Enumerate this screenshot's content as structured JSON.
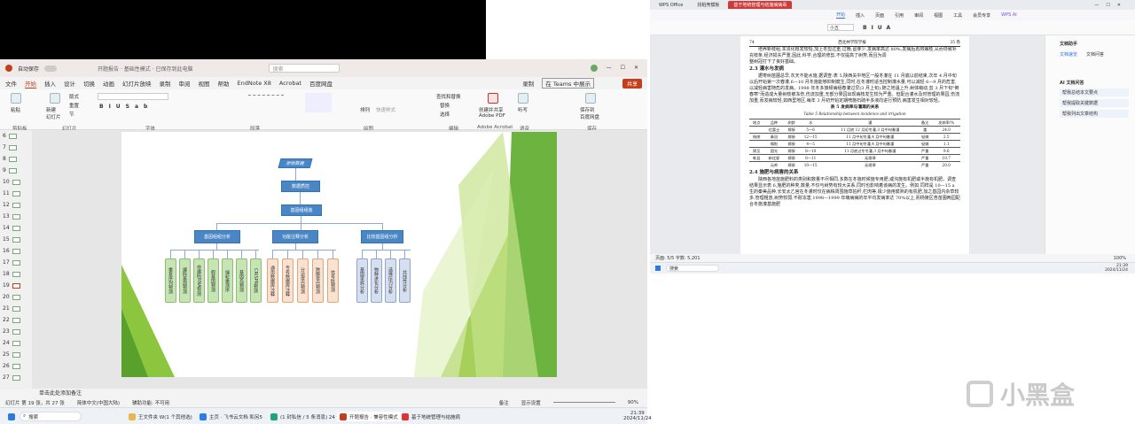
{
  "ppt": {
    "quick_access": "自动保存",
    "title_center": "开题报告 · 基础性模式 · 已保存到此电脑",
    "search_placeholder": "搜索",
    "menu": [
      "文件",
      "开始",
      "插入",
      "设计",
      "切换",
      "动画",
      "幻灯片放映",
      "录制",
      "审阅",
      "视图",
      "帮助",
      "EndNote X8",
      "Acrobat",
      "百度网盘"
    ],
    "active_menu": "开始",
    "record_label": "录制",
    "teams_label": "在 Teams 中展示",
    "share_label": "共享",
    "ribbon": {
      "paste": "粘贴",
      "new_slide": "新建\n幻灯片",
      "layout": "版式",
      "reset": "重置",
      "section": "节",
      "groups": [
        "剪贴板",
        "幻灯片",
        "字体",
        "段落",
        "绘图",
        "编辑",
        "Adobe Acrobat",
        "语音",
        "保存"
      ],
      "arrange": "排列",
      "quick_styles": "快速样式",
      "find": "查找和替换",
      "replace": "替换",
      "select": "选择",
      "create_pdf": "创建并共享\nAdobe PDF",
      "dictate": "听写",
      "save_baidu": "保存到\n百度网盘"
    },
    "thumbnails": [
      6,
      7,
      8,
      9,
      10,
      11,
      12,
      13,
      14,
      15,
      16,
      17,
      18,
      19,
      20,
      21,
      22,
      23,
      24,
      25,
      26,
      27
    ],
    "selected_thumb": 19,
    "slide": {
      "top": "原始数据",
      "step2": "数据质控",
      "step3": "基因组组装",
      "mid": [
        "基因组组分析",
        "功能注释分析",
        "比较基因组分析"
      ],
      "leaves_green": [
        "重复序列预测",
        "编码基因预测",
        "非编码RNA预测",
        "假基因预测",
        "端粒重测序",
        "基因岛预测",
        "CRISPR预测"
      ],
      "leaves_orange": [
        "通用数据库注释",
        "专有数据库注释",
        "分泌蛋白预测",
        "跨膜蛋白预测",
        "信号肽预测"
      ],
      "leaves_blue": [
        "基因家族分析",
        "物种进化分析",
        "选择压力分析",
        "共线性分析"
      ]
    },
    "notes_placeholder": "单击此处添加备注",
    "status": {
      "slide_count": "幻灯片 第 19 张，共 27 张",
      "language": "简体中文(中国大陆)",
      "accessibility": "辅助功能: 不可用",
      "notes": "备注",
      "display": "显示设置",
      "zoom": "90%"
    }
  },
  "taskbar_left": {
    "search": "搜索",
    "items": [
      "王文件夹 W(1 个其他选)",
      "主页 · 飞书云文档 和另5",
      "(1 封私信 / 5 条消息) 24",
      "开题报告 · 兼容性模式",
      "基于地统管理与结施病"
    ],
    "time": "21:39",
    "date": "2024/11/24"
  },
  "wps": {
    "tabs": [
      "WPS Office",
      "找稻壳模板",
      "基于地统管理与结施病病毒"
    ],
    "menu": [
      "开始",
      "插入",
      "页面",
      "引用",
      "审阅",
      "视图",
      "工具",
      "会员专享",
      "WPS AI"
    ],
    "active_menu": "开始",
    "font_size": "小五",
    "doc_header_left": "74",
    "doc_header_center": "西北林学院学报",
    "doc_header_right": "35 卷",
    "paragraphs": [
      "培养新枝组,本须化根发较短,加上冬剪过重,过晚,留芽少,发病率高达 80%,发病后再将病枝,从而导致补充枝条,经济损失严重,因此,科学,合理的修剪,不仅提高了树势,而且为调",
      "整树冠打下了良好基础。"
    ],
    "section_23": "2.3  灌水与发病",
    "para_23": "据枣树苗圃总早,灰天不能水施,据调查:表 5,陕西关中地区一般冬灌在 11 月底以前结束,次年 4 月中旬以后开始第一次春灌,6—10 月冬施能够抑制腐生,同时,在冬灌时适当控制灌水量,可以减轻 6—9 月的危害,以减轻病害随危的发病。1998 年冬多旅频病组春灌过早(3 月上旬),随之地温上升,树体萌动,剪 3 月下旬\"倒春寒\"而造成大量树枝被冻伤,伤流加重,无部分果园出现病枝发生较为严重。但配合灌水及时管理的果园,伤流加重,而发病较轻,如西里地区,每年 3 月初开始定期喷施石硫半多液向进行预防,病害发生相对较轻。",
    "table_title": "表 5  发病率与灌溉的关系",
    "table_subtitle": "Table 5  Relationship between incidence and irrigation",
    "table_head": [
      "地点",
      "品种",
      "树龄",
      "水",
      "灌",
      "备注",
      "发病率/%"
    ],
    "table_rows": [
      [
        "",
        "红富士",
        "嫁接",
        "5—6",
        "11 月底 12 月初冬灌,3 月中旬春灌",
        "重",
        "24.0"
      ],
      [
        "杨陵",
        "秦冠",
        "嫁接",
        "12—15",
        "11 月中旬冬灌,4 月中旬春灌",
        "轻微",
        "2.5"
      ],
      [
        "",
        "嘎啦",
        "嫁接",
        "4—5",
        "11 月中旬冬灌,4 月中旬春灌",
        "轻微",
        "1.1"
      ],
      [
        "周至",
        "国光",
        "嫁接",
        "8—10",
        "11 月底过冬冬灌,3 月中旬春灌",
        "严重",
        "9.6"
      ],
      [
        "乾县",
        "新红星",
        "嫁接",
        "8—11",
        "无规律",
        "严重",
        "10.7"
      ],
      [
        "",
        "元帅",
        "嫁接",
        "10—15",
        "无规律",
        "严重",
        "20.0"
      ]
    ],
    "section_24": "2.4  施肥与病害的关系",
    "para_24": "陕西各地苗施肥料的类别和数量不尽相同,多数在冬施时候施专用肥,或沟施有机肥或半施有机肥。调查结果显示表 6,施肥的种类,数量,不仅与树势有较大关系,同时也影响着该病的发生。例如,同样是 10—15 a 生的秦美品种,长安太乙宫在冬灌时仅在病株周围施草拍秆,栏肉等,极少施用腐熟的有机肥,加之基园内杂草较多,管理粗放,树势较弱,不耐冻害,1998—1999 年萌病病的年平均发病率达 70%以上,而杨陵区杏苗圃两园配合冬施灌基施肥",
    "side_panel": {
      "title": "文档助手",
      "tabs": [
        "文档速览",
        "文档问答"
      ],
      "section": "AI 文档问答",
      "items": [
        "帮我总结本文要点",
        "帮我提取关键数据",
        "帮我列出文章结构"
      ]
    },
    "status": "页面: 5/5  字数: 5,201",
    "zoom": "100%",
    "task_search": "搜索",
    "task_time": "21:39",
    "task_date": "2024/11/24"
  },
  "watermark": "小黑盒"
}
